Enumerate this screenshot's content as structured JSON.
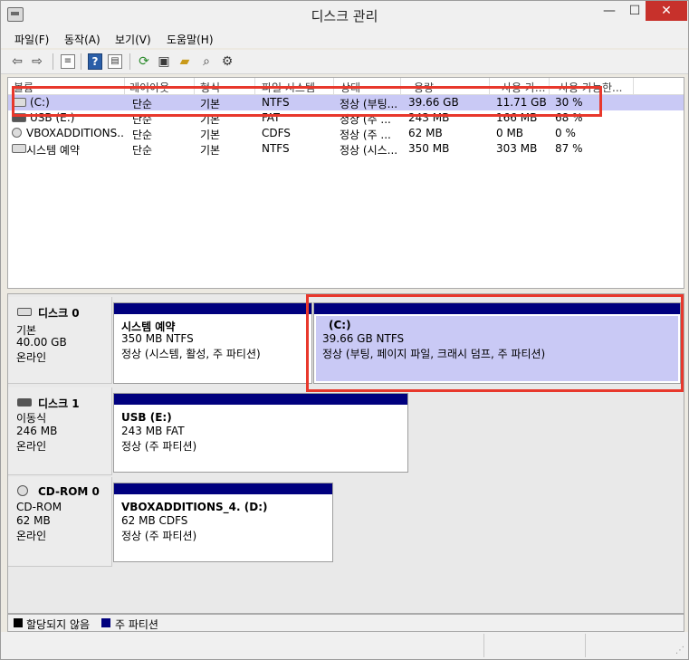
{
  "window": {
    "title": "디스크 관리",
    "min": "—",
    "max": "☐",
    "close": "✕"
  },
  "menu": [
    "파일(F)",
    "동작(A)",
    "보기(V)",
    "도움말(H)"
  ],
  "toolbar": {
    "icons": [
      "back-arrow-icon",
      "forward-arrow-icon",
      "disk-list-icon",
      "help-icon",
      "panel-icon",
      "refresh-icon",
      "properties-icon",
      "open-folder-icon",
      "search-icon",
      "options-icon"
    ],
    "help_label": "?"
  },
  "volumes": {
    "headers": [
      "볼륨",
      "레이아웃",
      "형식",
      "파일 시스템",
      "상태",
      "용량",
      "사용 가...",
      "사용 가능한..."
    ],
    "rows": [
      [
        "(C:)",
        "단순",
        "기본",
        "NTFS",
        "정상 (부팅...",
        "39.66 GB",
        "11.71 GB",
        "30 %"
      ],
      [
        "USB (E:)",
        "단순",
        "기본",
        "FAT",
        "정상 (주 ...",
        "243 MB",
        "166 MB",
        "68 %"
      ],
      [
        "VBOXADDITIONS...",
        "단순",
        "기본",
        "CDFS",
        "정상 (주 ...",
        "62 MB",
        "0 MB",
        "0 %"
      ],
      [
        "시스템 예약",
        "단순",
        "기본",
        "NTFS",
        "정상 (시스...",
        "350 MB",
        "303 MB",
        "87 %"
      ]
    ]
  },
  "disks": [
    {
      "name": "디스크 0",
      "type": "기본",
      "size": "40.00 GB",
      "status": "온라인",
      "partitions": [
        {
          "title": "시스템 예약",
          "detail": "350 MB NTFS",
          "status": "정상 (시스템, 활성, 주 파티션)"
        },
        {
          "title": "(C:)",
          "detail": "39.66 GB NTFS",
          "status": "정상 (부팅, 페이지 파일, 크래시 덤프, 주 파티션)"
        }
      ]
    },
    {
      "name": "디스크 1",
      "type": "이동식",
      "size": "246 MB",
      "status": "온라인",
      "partitions": [
        {
          "title": "USB  (E:)",
          "detail": "243 MB FAT",
          "status": "정상 (주 파티션)"
        }
      ]
    },
    {
      "name": "CD-ROM 0",
      "type": "CD-ROM",
      "size": "62 MB",
      "status": "온라인",
      "partitions": [
        {
          "title": "VBOXADDITIONS_4.  (D:)",
          "detail": "62 MB CDFS",
          "status": "정상 (주 파티션)"
        }
      ]
    }
  ],
  "legend": {
    "unallocated": "할당되지 않음",
    "primary": "주 파티션"
  },
  "colors": {
    "partition_bar": "#00007e",
    "selection": "#c9c9f5",
    "unallocated": "#000000",
    "highlight_box": "#e8382c"
  }
}
